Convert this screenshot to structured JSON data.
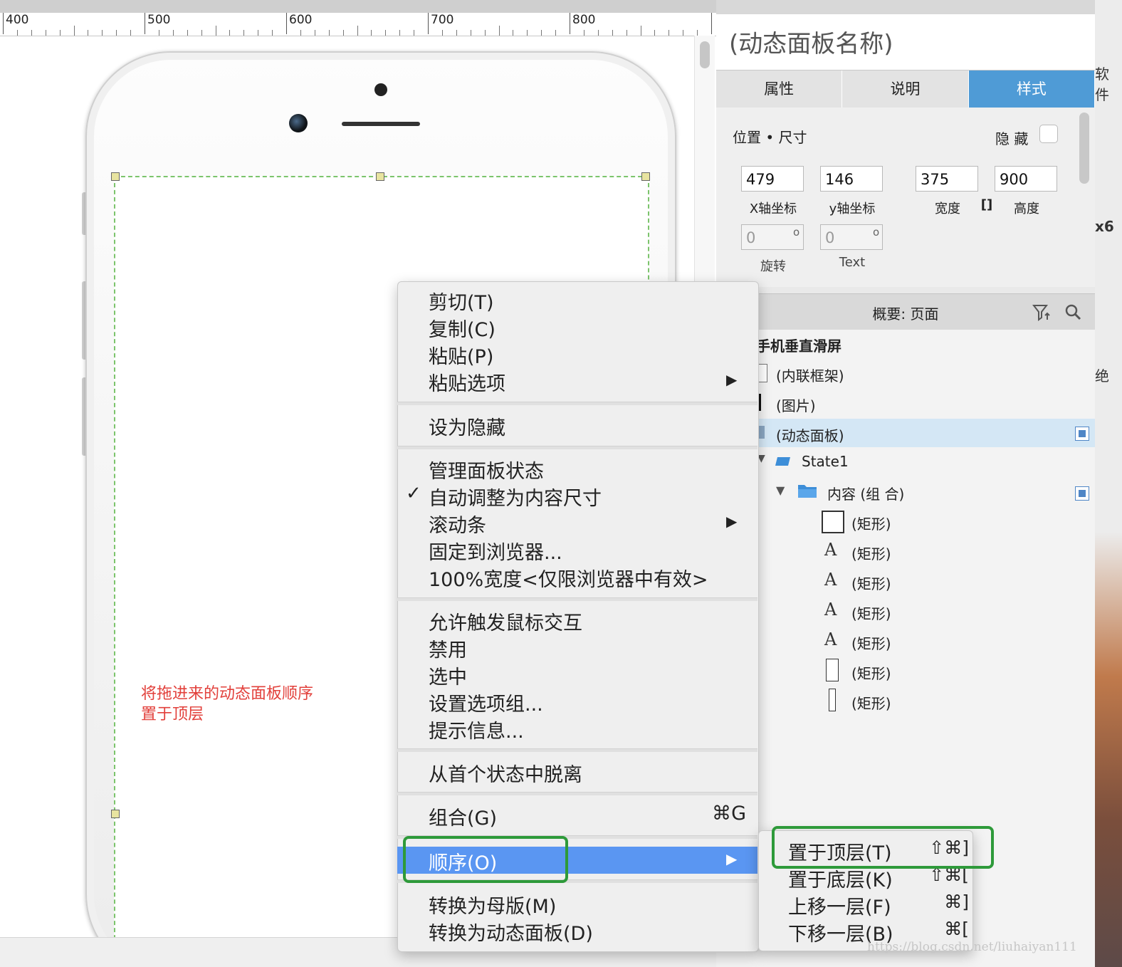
{
  "ruler": {
    "labels": [
      "400",
      "500",
      "600",
      "700",
      "800"
    ]
  },
  "annotation": {
    "line1": "将拖进来的动态面板顺序",
    "line2": "置于顶层"
  },
  "panel": {
    "title": "(动态面板名称)",
    "tabs": [
      "属性",
      "说明",
      "样式"
    ],
    "active_tab": "样式",
    "section_label": "位置 • 尺寸",
    "hide_label": "隐 藏",
    "x_value": "479",
    "x_label": "X轴坐标",
    "y_value": "146",
    "y_label": "y轴坐标",
    "w_value": "375",
    "w_label": "宽度",
    "h_value": "900",
    "h_label": "高度",
    "rotate_value": "0",
    "rotate_label": "旋转",
    "text_rotate_value": "0",
    "text_rotate_label": "Text",
    "degree_mark": "o",
    "link_icon": "[]"
  },
  "outline": {
    "title": "概要: 页面",
    "items": [
      {
        "label": "手机垂直滑屏",
        "icon": "none"
      },
      {
        "label": "(内联框架)",
        "icon": "frame-icon"
      },
      {
        "label": "(图片)",
        "icon": "image-icon"
      },
      {
        "label": "(动态面板)",
        "icon": "dynamic-panel-icon",
        "selected": true
      },
      {
        "label": "State1",
        "icon": "state-icon"
      },
      {
        "label": "内容 (组 合)",
        "icon": "folder-icon"
      },
      {
        "label": "(矩形)",
        "icon": "rectangle-icon"
      },
      {
        "label": "(矩形)",
        "icon": "text-a-icon"
      },
      {
        "label": "(矩形)",
        "icon": "text-a-icon"
      },
      {
        "label": "(矩形)",
        "icon": "text-a-icon"
      },
      {
        "label": "(矩形)",
        "icon": "text-a-icon"
      },
      {
        "label": "(矩形)",
        "icon": "rectangle-icon"
      },
      {
        "label": "(矩形)",
        "icon": "narrow-rectangle-icon"
      }
    ],
    "expand_glyph": "▼"
  },
  "context_menu": {
    "items": {
      "cut": "剪切(T)",
      "copy": "复制(C)",
      "paste": "粘贴(P)",
      "paste_options": "粘贴选项",
      "set_hidden": "设为隐藏",
      "manage_states": "管理面板状态",
      "auto_fit": "自动调整为内容尺寸",
      "scrollbars": "滚动条",
      "pin_browser": "固定到浏览器...",
      "full_width": "100%宽度<仅限浏览器中有效>",
      "allow_mouse": "允许触发鼠标交互",
      "disable": "禁用",
      "select": "选中",
      "option_group": "设置选项组...",
      "tooltip": "提示信息...",
      "break_away": "从首个状态中脱离",
      "group": "组合(G)",
      "order": "顺序(O)",
      "to_master": "转换为母版(M)",
      "to_dynamic": "转换为动态面板(D)"
    },
    "group_shortcut": "⌘G",
    "check_mark": "✓",
    "submenu_arrow": "▶"
  },
  "submenu": {
    "items": [
      {
        "label": "置于顶层(T)",
        "shortcut": "⇧⌘]"
      },
      {
        "label": "置于底层(K)",
        "shortcut": "⇧⌘["
      },
      {
        "label": "上移一层(F)",
        "shortcut": "⌘]"
      },
      {
        "label": "下移一层(B)",
        "shortcut": "⌘["
      }
    ]
  },
  "far_right": {
    "top_text": "软件",
    "mid_text": "x6",
    "low_text": "绝"
  },
  "watermark": "https://blog.csdn.net/liuhaiyan111",
  "colors": {
    "accent_tab": "#4f9bd6",
    "menu_highlight": "#5a96f2",
    "green_highlight": "#2e9a3a",
    "annotation": "#e2403b",
    "selection_row": "#d4e7f5"
  }
}
